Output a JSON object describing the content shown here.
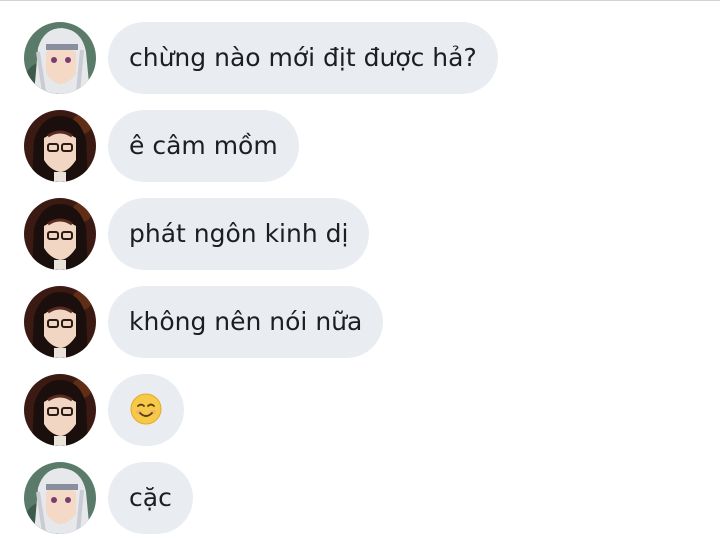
{
  "messages": [
    {
      "sender": "white-hair",
      "text": "chừng nào mới địt được hả?"
    },
    {
      "sender": "dark-hair",
      "text": "ê câm mồm"
    },
    {
      "sender": "dark-hair",
      "text": "phát ngôn kinh dị"
    },
    {
      "sender": "dark-hair",
      "text": "không nên nói nữa"
    },
    {
      "sender": "dark-hair",
      "text": "",
      "emoji": "smiling-face-emoji"
    },
    {
      "sender": "white-hair",
      "text": "cặc"
    }
  ],
  "colors": {
    "bubble": "#e9edf2",
    "text": "#1c1e21",
    "divider": "#cfd3d8"
  }
}
